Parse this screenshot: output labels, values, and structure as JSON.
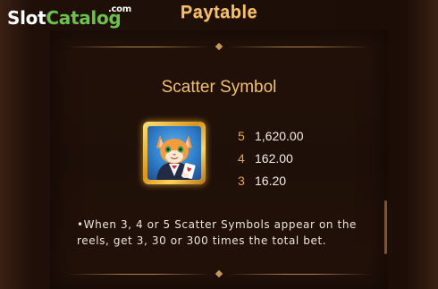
{
  "header": {
    "title": "Paytable",
    "logo": {
      "slot": "Slot",
      "catalog": "Catalog",
      "com": ".com"
    }
  },
  "scatter": {
    "title": "Scatter Symbol",
    "symbol_icon": "cat-with-ace-card-icon",
    "pays": [
      {
        "count": "5",
        "amount": "1,620.00"
      },
      {
        "count": "4",
        "amount": "162.00"
      },
      {
        "count": "3",
        "amount": "16.20"
      }
    ],
    "description": "•When 3, 4 or 5 Scatter Symbols appear on the reels, get 3, 30 or 300 times the total bet."
  },
  "colors": {
    "accent_gold": "#f0c070",
    "count_orange": "#e8a940",
    "logo_green": "#6cc14a",
    "background": "#1e0f08"
  }
}
